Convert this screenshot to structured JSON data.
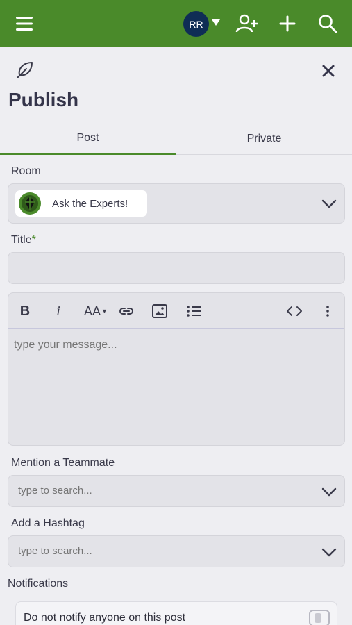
{
  "header": {
    "avatar_initials": "RR",
    "brand_color": "#4a8a2a",
    "icons": [
      "hamburger-icon",
      "caret-down-icon",
      "add-user-icon",
      "plus-icon",
      "search-icon"
    ]
  },
  "page": {
    "title": "Publish",
    "close_icon": "close-icon",
    "feather_icon": "feather-icon"
  },
  "tabs": [
    {
      "label": "Post",
      "active": true
    },
    {
      "label": "Private",
      "active": false
    }
  ],
  "form": {
    "room_label": "Room",
    "room_value": "Ask the Experts!",
    "title_label": "Title",
    "title_required_mark": "*",
    "title_value": "",
    "editor_placeholder": "type your message...",
    "editor_toolbar": {
      "bold": "B",
      "italic": "i",
      "font_size": "AA"
    },
    "mention_label": "Mention a Teammate",
    "mention_placeholder": "type to search...",
    "hashtag_label": "Add a Hashtag",
    "hashtag_placeholder": "type to search...",
    "notifications_label": "Notifications",
    "notify_option_label": "Do not notify anyone on this post",
    "notify_option_checked": false
  }
}
